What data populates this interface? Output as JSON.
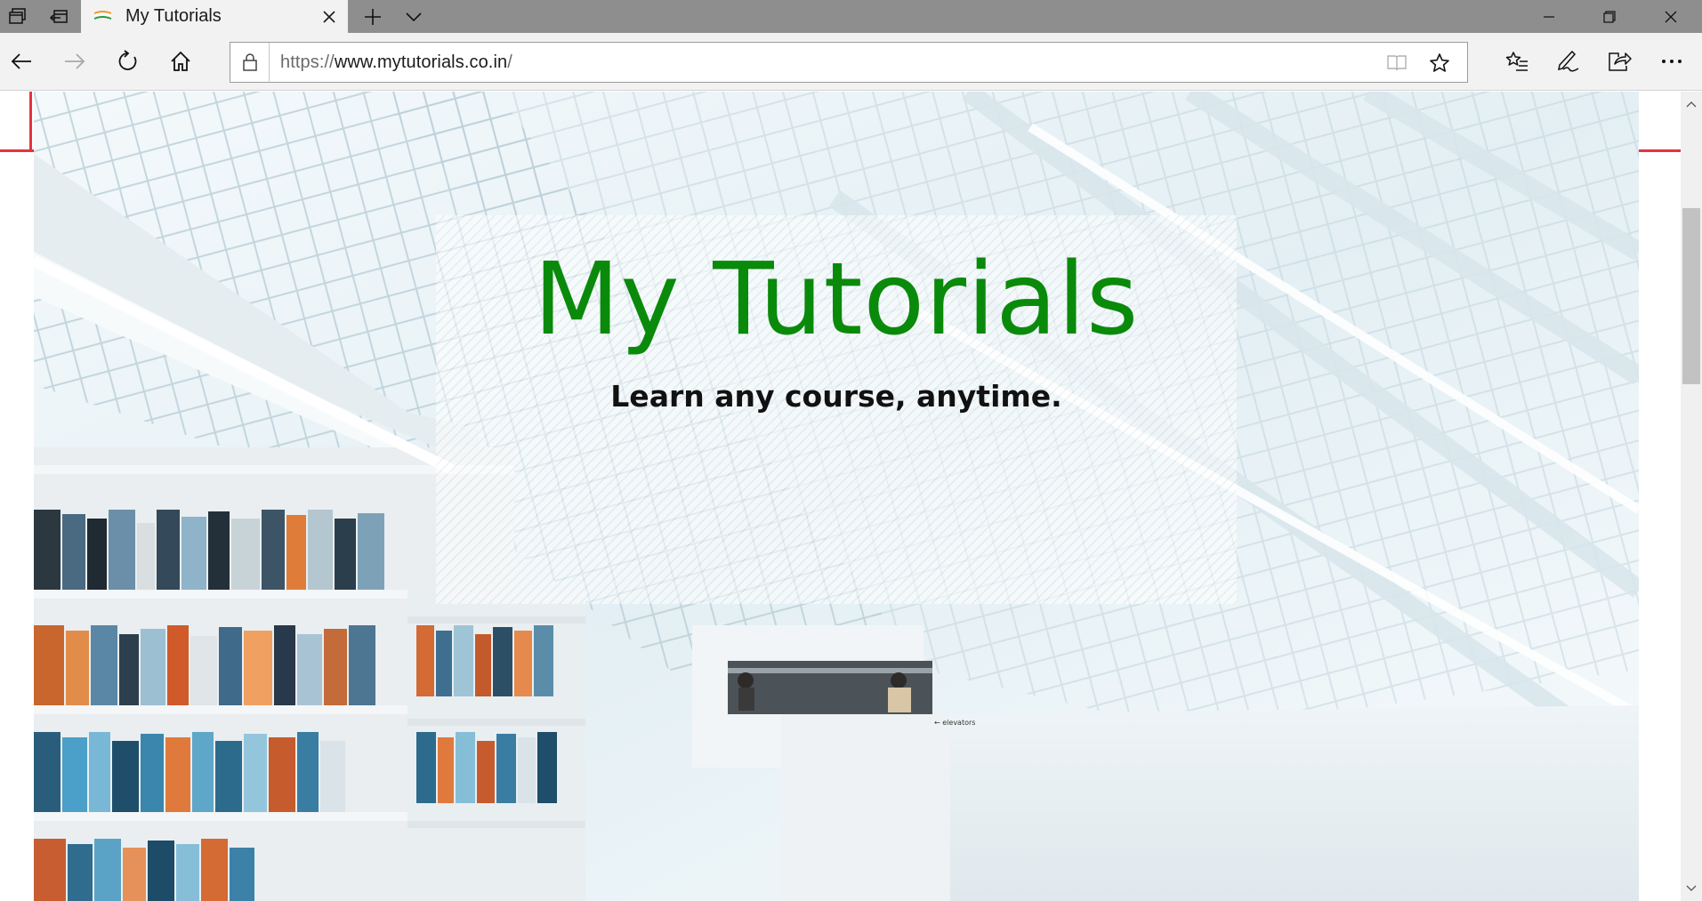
{
  "browser": {
    "tab": {
      "title": "My Tutorials"
    },
    "address": {
      "protocol": "https://",
      "host": "www.mytutorials.co.in",
      "path": "/"
    }
  },
  "page": {
    "hero": {
      "title": "My Tutorials",
      "tagline": "Learn any course, anytime.",
      "sign_text": "← elevators"
    }
  },
  "colors": {
    "title_green": "#0a8a0a",
    "accent_red": "#e5333f",
    "tab_strip": "#8e8e8e",
    "toolbar": "#f2f2f2"
  },
  "icons": [
    "tab-preview-icon",
    "set-aside-tabs-icon",
    "new-tab-icon",
    "tab-list-chevron-icon",
    "minimize-icon",
    "restore-icon",
    "close-window-icon",
    "back-icon",
    "forward-icon",
    "refresh-icon",
    "home-icon",
    "lock-icon",
    "reading-view-icon",
    "favorite-star-icon",
    "favorites-hub-icon",
    "web-note-icon",
    "share-icon",
    "more-icon"
  ]
}
